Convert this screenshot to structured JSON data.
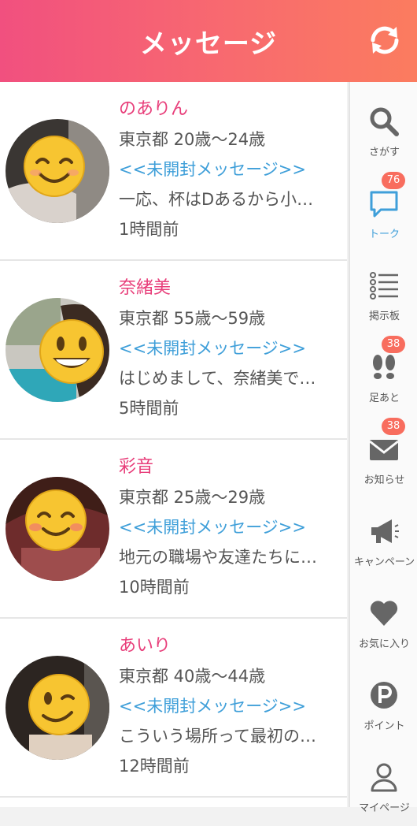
{
  "header": {
    "title": "メッセージ"
  },
  "messages": [
    {
      "name": "のありん",
      "location_age": "東京都 20歳〜24歳",
      "status": "<<未開封メッセージ>>",
      "preview": "一応、杯はDあるから小…",
      "time": "1時間前"
    },
    {
      "name": "奈緒美",
      "location_age": "東京都 55歳〜59歳",
      "status": "<<未開封メッセージ>>",
      "preview": "はじめまして、奈緒美で…",
      "time": "5時間前"
    },
    {
      "name": "彩音",
      "location_age": "東京都 25歳〜29歳",
      "status": "<<未開封メッセージ>>",
      "preview": "地元の職場や友達たちに…",
      "time": "10時間前"
    },
    {
      "name": "あいり",
      "location_age": "東京都 40歳〜44歳",
      "status": "<<未開封メッセージ>>",
      "preview": "こういう場所って最初の…",
      "time": "12時間前"
    }
  ],
  "sidebar": {
    "items": [
      {
        "label": "さがす",
        "icon": "search-icon",
        "badge": null
      },
      {
        "label": "トーク",
        "icon": "chat-bubble-icon",
        "badge": "76",
        "active": true
      },
      {
        "label": "掲示板",
        "icon": "list-icon",
        "badge": null
      },
      {
        "label": "足あと",
        "icon": "footprints-icon",
        "badge": "38"
      },
      {
        "label": "お知らせ",
        "icon": "envelope-icon",
        "badge": "38"
      },
      {
        "label": "キャンペーン",
        "icon": "megaphone-icon",
        "badge": null
      },
      {
        "label": "お気に入り",
        "icon": "heart-icon",
        "badge": null
      },
      {
        "label": "ポイント",
        "icon": "points-icon",
        "badge": null
      },
      {
        "label": "マイページ",
        "icon": "person-icon",
        "badge": null
      }
    ]
  },
  "colors": {
    "header_start": "#f1507f",
    "header_end": "#fb7c5f",
    "name": "#e83e7a",
    "unread": "#3f9fd9",
    "badge": "#f86d5e"
  }
}
